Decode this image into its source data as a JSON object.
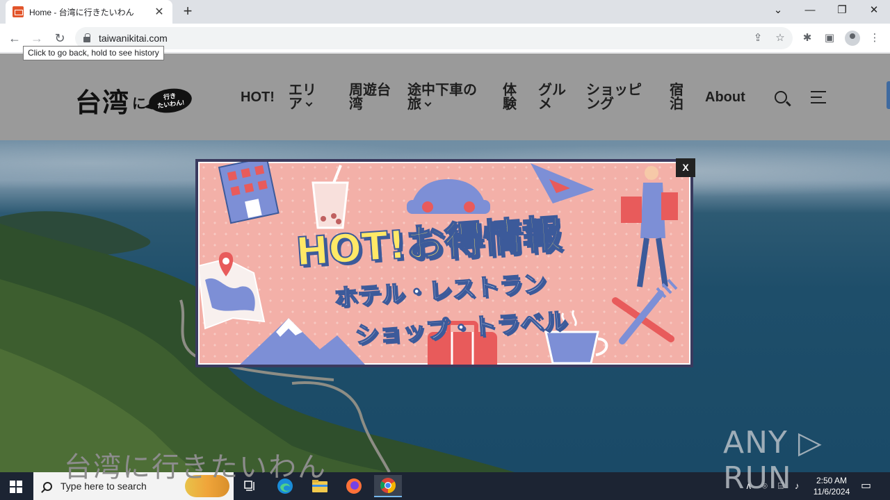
{
  "browser": {
    "tab_title": "Home - 台湾に行きたいわん",
    "tab_close": "✕",
    "new_tab": "+",
    "url": "taiwanikitai.com",
    "tooltip": "Click to go back, hold to see history",
    "window_controls": {
      "dropdown": "⌄",
      "minimize": "—",
      "restore": "❐",
      "close": "✕"
    }
  },
  "site": {
    "logo": {
      "kanji": "台湾",
      "particle": "に",
      "bubble_line1": "行き",
      "bubble_line2": "たいわん!"
    },
    "nav": [
      {
        "label": "HOT!",
        "line2": "",
        "dropdown": false
      },
      {
        "label": "エリ",
        "line2": "ア",
        "dropdown": true
      },
      {
        "label": "周遊台",
        "line2": "湾",
        "dropdown": false
      },
      {
        "label": "途中下車の",
        "line2": "旅",
        "dropdown": true
      },
      {
        "label": "体",
        "line2": "験",
        "dropdown": false
      },
      {
        "label": "グル",
        "line2": "メ",
        "dropdown": false
      },
      {
        "label": "ショッピ",
        "line2": "ング",
        "dropdown": false
      },
      {
        "label": "宿",
        "line2": "泊",
        "dropdown": false
      },
      {
        "label": "About",
        "line2": "",
        "dropdown": false
      }
    ]
  },
  "hero": {
    "caption": "台湾に行きたいわん"
  },
  "popup": {
    "close_label": "X",
    "title": "HOT!お得情報",
    "line1": "ホテル・レストラン",
    "line2": "ショップ・トラベル"
  },
  "watermark": "ANY ▷ RUN",
  "taskbar": {
    "search_placeholder": "Type here to search",
    "time": "2:50 AM",
    "date": "11/6/2024",
    "tray_up": "∧"
  }
}
